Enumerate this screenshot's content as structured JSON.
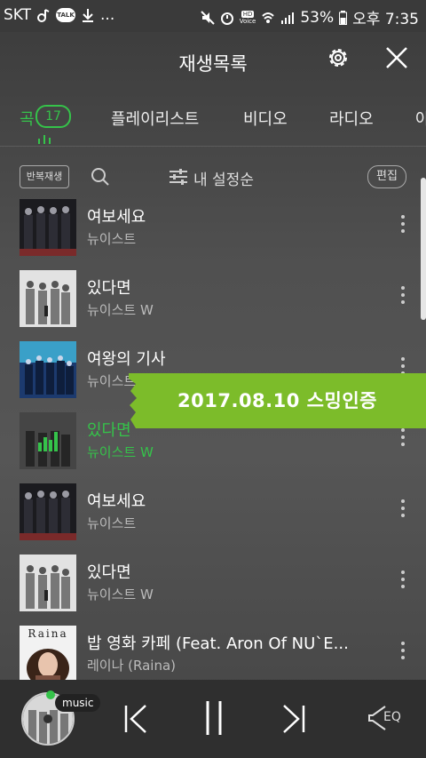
{
  "status": {
    "carrier": "SKT",
    "talk_label": "TALK",
    "ellipsis": "...",
    "hd_label": "HD",
    "voice_label": "Voice",
    "battery": "53%",
    "time": "오후 7:35"
  },
  "header": {
    "title": "재생목록"
  },
  "tabs": [
    {
      "label": "곡",
      "count": "17",
      "active": true
    },
    {
      "label": "플레이리스트"
    },
    {
      "label": "비디오"
    },
    {
      "label": "라디오"
    },
    {
      "label": "아"
    }
  ],
  "toolbar": {
    "repeat_label": "반복재생",
    "sort_label": "내 설정순",
    "edit_label": "편집"
  },
  "songs": [
    {
      "title": "여보세요",
      "artist": "뉴이스트",
      "playing": false
    },
    {
      "title": "있다면",
      "artist": "뉴이스트 W",
      "playing": false
    },
    {
      "title": "여왕의 기사",
      "artist": "뉴이스트",
      "playing": false
    },
    {
      "title": "있다면",
      "artist": "뉴이스트 W",
      "playing": true
    },
    {
      "title": "여보세요",
      "artist": "뉴이스트",
      "playing": false
    },
    {
      "title": "있다면",
      "artist": "뉴이스트 W",
      "playing": false
    },
    {
      "title": "밥 영화 카페 (Feat. Aron Of NU`E...",
      "artist": "레이나 (Raina)",
      "playing": false
    }
  ],
  "album_text": {
    "raina": "Raina"
  },
  "banner": {
    "text": "2017.08.10 스밍인증",
    "color": "#7cbc2a"
  },
  "player": {
    "music_tag": "music",
    "eq_label": "EQ"
  },
  "colors": {
    "accent": "#35c34a"
  }
}
